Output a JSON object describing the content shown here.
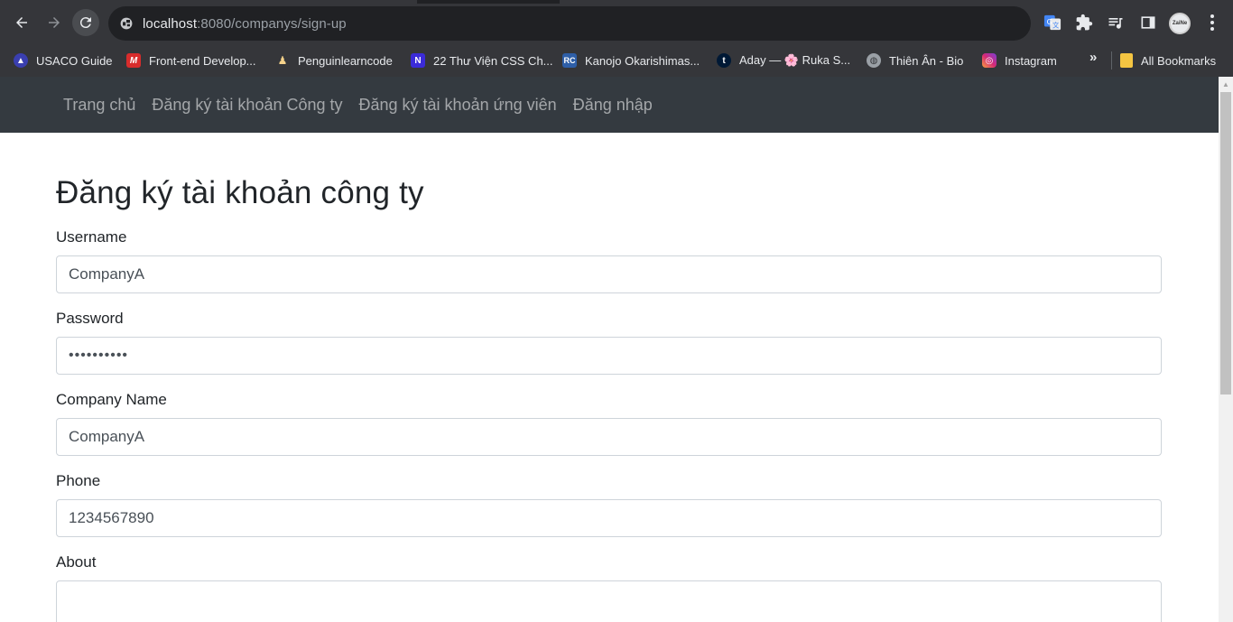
{
  "browser": {
    "url_host": "localhost",
    "url_rest": ":8080/companys/sign-up",
    "profile_label": "ZaiNe",
    "bookmarks": [
      {
        "label": "USACO Guide",
        "icon": "usaco-icon"
      },
      {
        "label": "Front-end Develop...",
        "icon": "frontend-icon"
      },
      {
        "label": "Penguinlearncode",
        "icon": "penguin-icon"
      },
      {
        "label": "22 Thư Viện CSS Ch...",
        "icon": "n-icon"
      },
      {
        "label": "Kanojo Okarishimas...",
        "icon": "rc-icon"
      },
      {
        "label": "Aday — 🌸 Ruka S...",
        "icon": "tumblr-icon"
      },
      {
        "label": "Thiên Ân - Bio",
        "icon": "globe-icon"
      },
      {
        "label": "Instagram",
        "icon": "instagram-icon"
      }
    ],
    "more_label": "»",
    "all_bookmarks_label": "All Bookmarks"
  },
  "navbar": {
    "links": [
      "Trang chủ",
      "Đăng ký tài khoản Công ty",
      "Đăng ký tài khoản ứng viên",
      "Đăng nhập"
    ]
  },
  "page": {
    "title": "Đăng ký tài khoản công ty",
    "fields": {
      "username": {
        "label": "Username",
        "value": "CompanyA"
      },
      "password": {
        "label": "Password",
        "value": "••••••••••"
      },
      "company_name": {
        "label": "Company Name",
        "value": "CompanyA"
      },
      "phone": {
        "label": "Phone",
        "value": "1234567890"
      },
      "about": {
        "label": "About",
        "value": ""
      }
    }
  },
  "colors": {
    "chrome_bg": "#35363a",
    "omnibox_bg": "#202124",
    "navbar_bg": "#343a40"
  }
}
